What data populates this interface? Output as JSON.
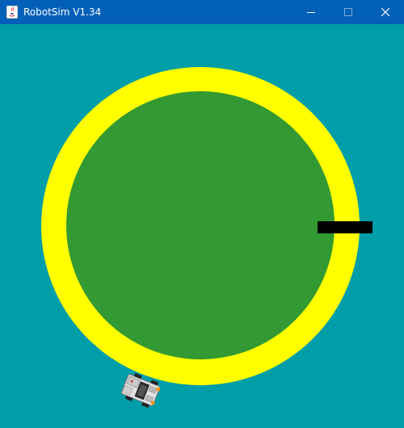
{
  "window": {
    "title": "RobotSim V1.34",
    "controls": {
      "minimize_icon": "minimize-icon",
      "maximize_icon": "maximize-icon",
      "close_icon": "close-icon"
    }
  },
  "scene": {
    "background_color": "#009ea8",
    "track": {
      "outer_color": "#ffff00",
      "inner_color": "#339933"
    },
    "marker": {
      "color": "#000000"
    },
    "robot": {
      "icon": "robot-icon",
      "body_color": "#e0e0e0",
      "accent_color": "#ff9900"
    }
  }
}
